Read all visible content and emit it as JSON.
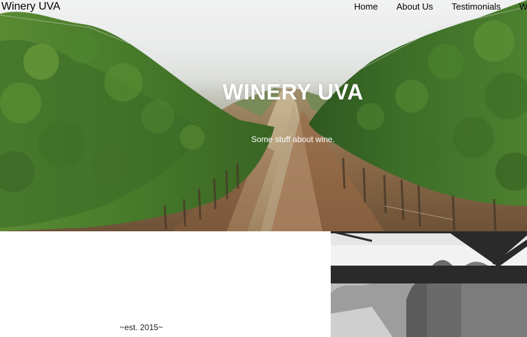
{
  "brand": "Winery UVA",
  "nav": {
    "items": [
      "Home",
      "About Us",
      "Testimonials",
      "Wi"
    ]
  },
  "hero": {
    "title": "WINERY UVA",
    "subtitle": "Some stuff about wine."
  },
  "about": {
    "established": "~est. 2015~"
  },
  "colors": {
    "hero_text": "#ffffff",
    "nav_text": "#000000",
    "background": "#ffffff"
  }
}
